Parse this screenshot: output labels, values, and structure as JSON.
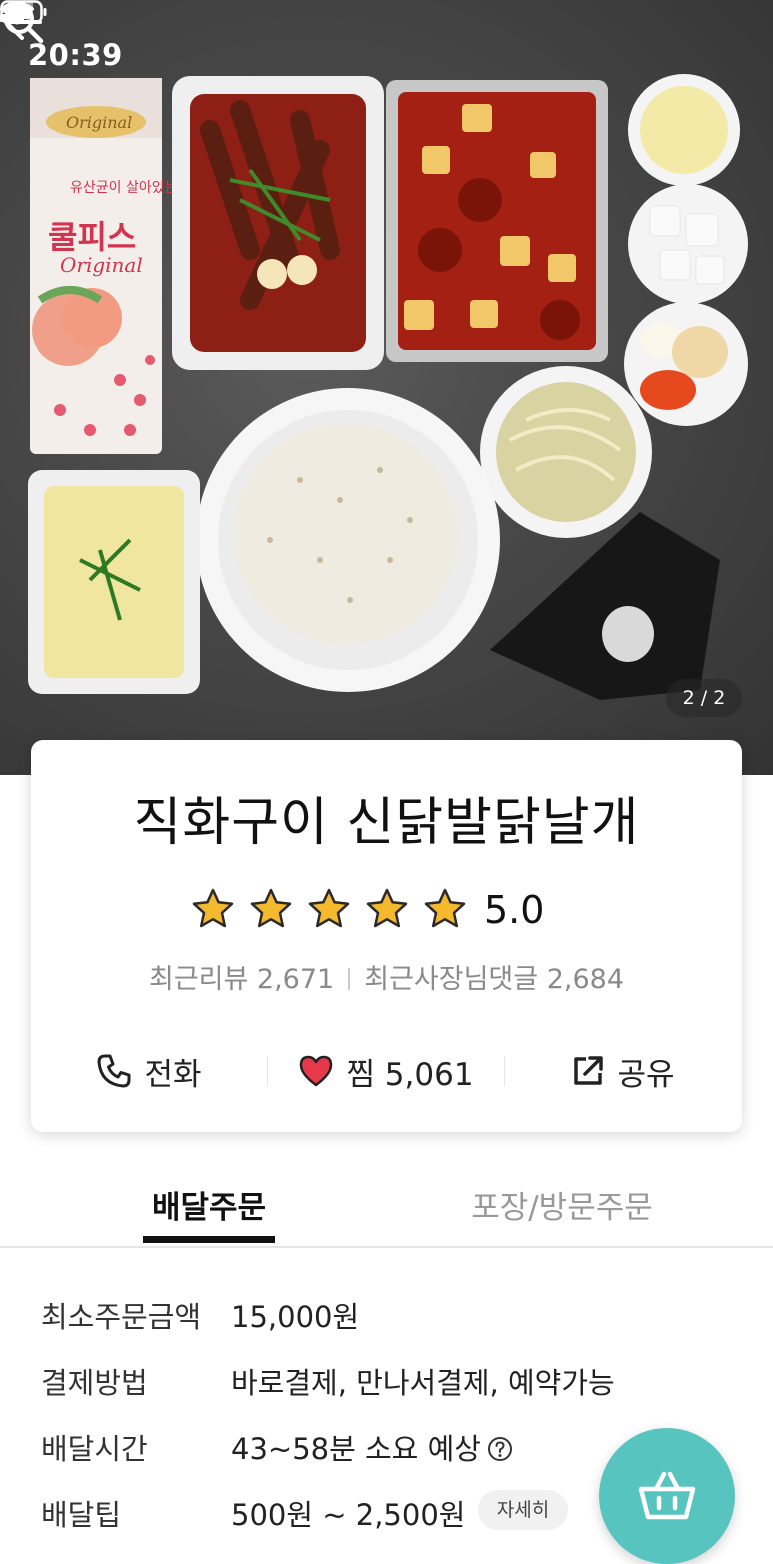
{
  "status_bar": {
    "time": "20:39"
  },
  "hero": {
    "page_indicator": "2 / 2"
  },
  "food_labels": {
    "milk_brand": "쿨피스",
    "milk_sub": "Original",
    "milk_top": "Original",
    "milk_note": "유산균이 살아있는"
  },
  "store": {
    "name": "직화구이 신닭발닭날개",
    "rating": "5.0",
    "star_count": 5,
    "recent_reviews": "최근리뷰 2,671",
    "owner_replies": "최근사장님댓글 2,684"
  },
  "actions": {
    "call": "전화",
    "favorite": "찜 5,061",
    "share": "공유"
  },
  "tabs": {
    "delivery": "배달주문",
    "takeout": "포장/방문주문"
  },
  "info": [
    {
      "label": "최소주문금액",
      "value": "15,000원"
    },
    {
      "label": "결제방법",
      "value": "바로결제, 만나서결제, 예약가능"
    },
    {
      "label": "배달시간",
      "value": "43~58분 소요 예상"
    },
    {
      "label": "배달팁",
      "value": "500원 ~ 2,500원"
    }
  ],
  "detail_badge": "자세히",
  "colors": {
    "accent": "#58c4c0",
    "star": "#f5b92e",
    "heart": "#e8394a"
  }
}
